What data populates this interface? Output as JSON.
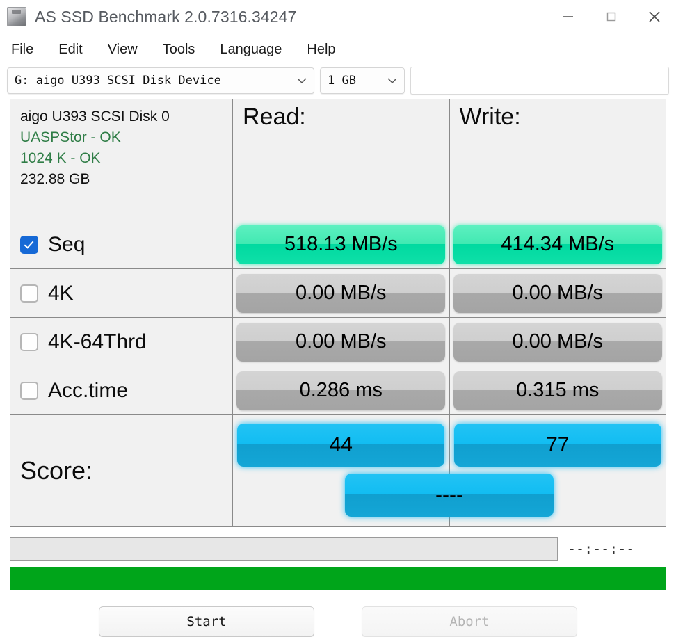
{
  "window": {
    "title": "AS SSD Benchmark 2.0.7316.34247",
    "icon": "ssd-drive-icon",
    "controls": {
      "minimize": "minimize-icon",
      "maximize": "maximize-icon",
      "close": "close-icon"
    }
  },
  "menu": {
    "items": [
      {
        "label": "File"
      },
      {
        "label": "Edit"
      },
      {
        "label": "View"
      },
      {
        "label": "Tools"
      },
      {
        "label": "Language"
      },
      {
        "label": "Help"
      }
    ]
  },
  "selector": {
    "drive": "G: aigo U393 SCSI Disk Device",
    "size": "1 GB",
    "note": "",
    "note_placeholder": ""
  },
  "disk_info": {
    "name": "aigo U393 SCSI Disk 0",
    "driver": "UASPStor - OK",
    "alignment": "1024 K - OK",
    "capacity": "232.88 GB",
    "ok_color": "#2f7d46"
  },
  "columns": {
    "read": "Read:",
    "write": "Write:"
  },
  "tests": [
    {
      "name": "Seq",
      "checked": true,
      "read": "518.13 MB/s",
      "write": "414.34 MB/s",
      "state": "done"
    },
    {
      "name": "4K",
      "checked": false,
      "read": "0.00 MB/s",
      "write": "0.00 MB/s",
      "state": "idle"
    },
    {
      "name": "4K-64Thrd",
      "checked": false,
      "read": "0.00 MB/s",
      "write": "0.00 MB/s",
      "state": "idle"
    },
    {
      "name": "Acc.time",
      "checked": false,
      "read": "0.286 ms",
      "write": "0.315 ms",
      "state": "idle"
    }
  ],
  "score": {
    "label": "Score:",
    "read": "44",
    "write": "77",
    "total": "----"
  },
  "status": {
    "message": "",
    "timer": "--:--:--",
    "progress_percent": 100,
    "progress_color": "#00a51a"
  },
  "buttons": {
    "start": "Start",
    "abort": "Abort"
  },
  "colors": {
    "accent_green": "#00d9a0",
    "accent_blue": "#12bdf2",
    "gray_pill": "#a9a9a9",
    "checkbox_on": "#1669d6"
  }
}
